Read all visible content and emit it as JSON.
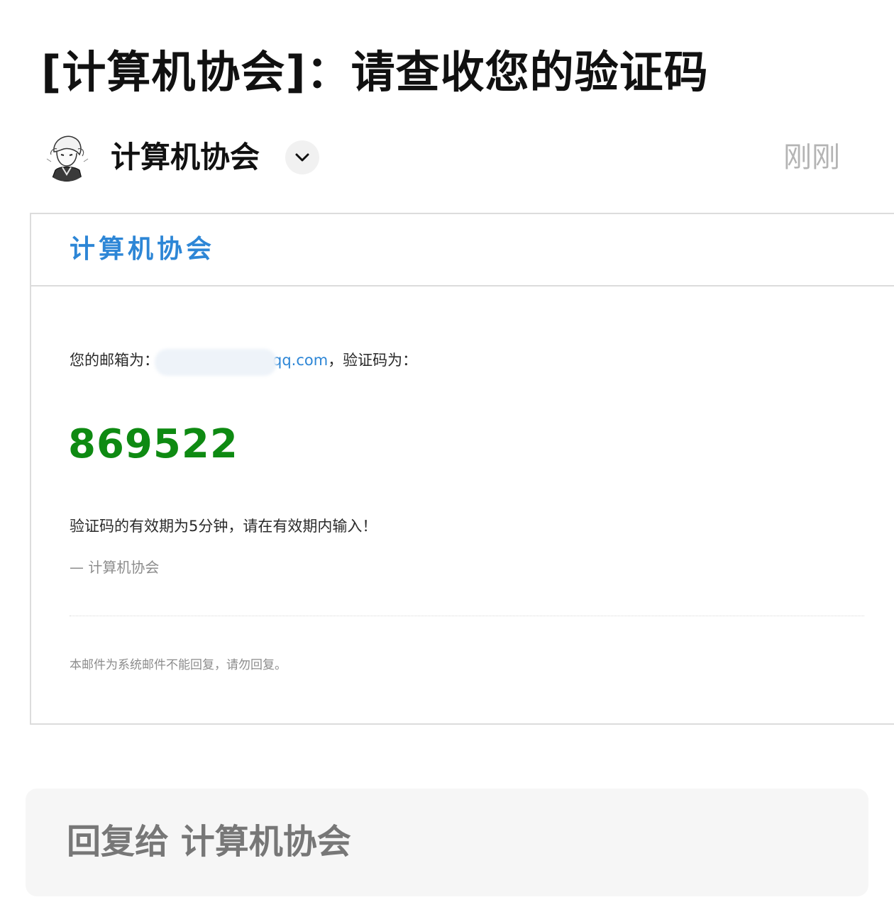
{
  "subject": "[计算机协会]：请查收您的验证码",
  "sender": {
    "name": "计算机协会",
    "time": "刚刚",
    "avatar_icon": "sketch-character-avatar",
    "expand_icon": "chevron-down-icon"
  },
  "mail": {
    "brand": "计算机协会",
    "email_prefix": "您的邮箱为：",
    "email_visible": "qq.com",
    "email_suffix": "，验证码为：",
    "code": "869522",
    "validity": "验证码的有效期为5分钟，请在有效期内输入！",
    "signature": "— 计算机协会",
    "footer_note": "本邮件为系统邮件不能回复，请勿回复。"
  },
  "reply": {
    "placeholder": "回复给 计算机协会"
  },
  "colors": {
    "brand_blue": "#2d86d6",
    "code_green": "#0e8a12",
    "muted_gray": "#8c8c8c"
  }
}
